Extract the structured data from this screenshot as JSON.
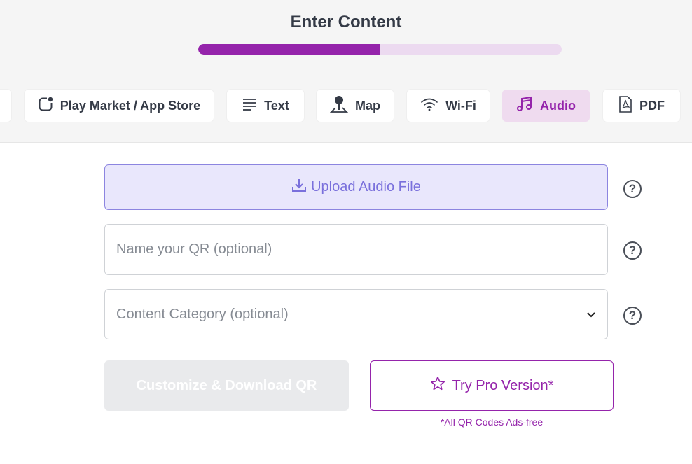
{
  "header": {
    "title": "Enter Content",
    "progress_fraction": 0.5
  },
  "tabs": [
    {
      "label": "",
      "icon": "partial-tab",
      "active": false
    },
    {
      "label": "Play Market / App Store",
      "icon": "app-store-icon",
      "active": false
    },
    {
      "label": "Text",
      "icon": "text-lines-icon",
      "active": false
    },
    {
      "label": "Map",
      "icon": "map-pin-icon",
      "active": false
    },
    {
      "label": "Wi-Fi",
      "icon": "wifi-icon",
      "active": false
    },
    {
      "label": "Audio",
      "icon": "music-note-icon",
      "active": true
    },
    {
      "label": "PDF",
      "icon": "pdf-file-icon",
      "active": false
    }
  ],
  "form": {
    "upload_label": "Upload Audio File",
    "name_placeholder": "Name your QR (optional)",
    "name_value": "",
    "category_placeholder": "Content Category (optional)",
    "help_glyph": "?"
  },
  "actions": {
    "download_label": "Customize & Download QR",
    "pro_label": "Try Pro Version*",
    "pro_note": "*All QR Codes Ads-free"
  },
  "colors": {
    "accent": "#9524ab",
    "accent_light": "#efdbef",
    "upload_bg": "#e9e7fc",
    "upload_border": "#8c85e0",
    "disabled_bg": "#e9eaec"
  }
}
